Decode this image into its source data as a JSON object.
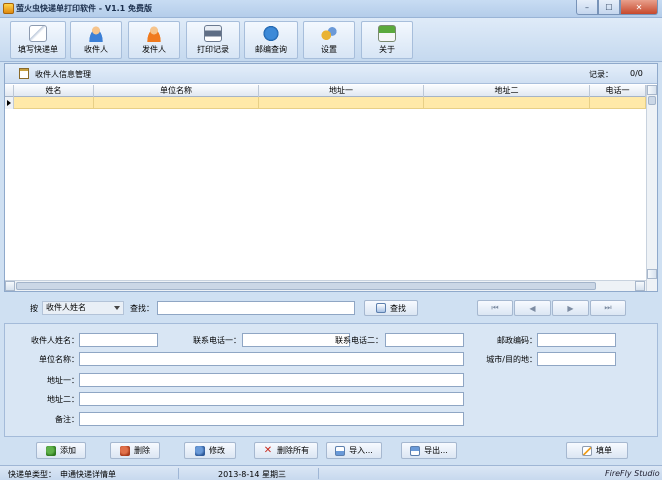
{
  "window": {
    "title": "萤火虫快递单打印软件 - V1.1 免费版",
    "min_glyph": "–",
    "max_glyph": "☐",
    "close_glyph": "✕"
  },
  "toolbar": {
    "items": [
      {
        "label": "填写快递单",
        "icon": "write-form-icon"
      },
      {
        "label": "收件人",
        "icon": "recipient-person-icon"
      },
      {
        "label": "发件人",
        "icon": "sender-person-icon"
      },
      {
        "label": "打印记录",
        "icon": "print-record-icon"
      },
      {
        "label": "邮编查询",
        "icon": "postal-search-icon"
      },
      {
        "label": "设置",
        "icon": "gears-icon"
      },
      {
        "label": "关于",
        "icon": "about-house-icon"
      }
    ]
  },
  "panel": {
    "title": "收件人信息管理",
    "record_label": "记录：",
    "record_value": "0/0"
  },
  "grid": {
    "columns": [
      "姓名",
      "单位名称",
      "地址一",
      "地址二",
      "电话一"
    ]
  },
  "search": {
    "by_label": "按",
    "field_selected": "收件人姓名",
    "find_label": "查找：",
    "find_value": "",
    "find_button": "查找",
    "nav": [
      "⏮",
      "◀",
      "▶",
      "⏭"
    ]
  },
  "form": {
    "name_label": "收件人姓名：",
    "phone1_label": "联系电话一：",
    "phone2_label": "联系电话二：",
    "zip_label": "邮政编码：",
    "company_label": "单位名称：",
    "city_label": "城市/目的地：",
    "addr1_label": "地址一：",
    "addr2_label": "地址二：",
    "note_label": "备注：",
    "values": {
      "name": "",
      "phone1": "",
      "phone2": "",
      "zip": "",
      "company": "",
      "city": "",
      "addr1": "",
      "addr2": "",
      "note": ""
    }
  },
  "actions": {
    "add": "添加",
    "delete": "删除",
    "edit": "修改",
    "delete_all": "删除所有",
    "import": "导入...",
    "export": "导出...",
    "fill": "填单"
  },
  "status": {
    "type_label": "快递单类型：",
    "type_value": "申通快递详情单",
    "date": "2013-8-14 星期三",
    "studio": "FireFly Studio"
  }
}
